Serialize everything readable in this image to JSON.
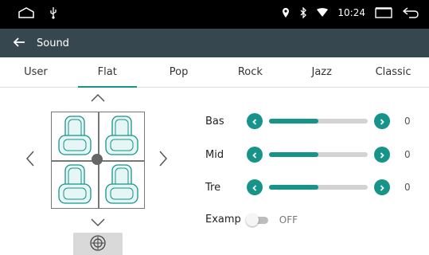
{
  "status_bar": {
    "time": "10:24",
    "icons": [
      "home-outline-icon",
      "usb-icon",
      "location-icon",
      "bluetooth-icon",
      "wifi-icon",
      "recent-apps-icon",
      "return-icon"
    ]
  },
  "header": {
    "title": "Sound",
    "background": "#37474f"
  },
  "tabs": [
    {
      "label": "User",
      "active": false
    },
    {
      "label": "Flat",
      "active": true
    },
    {
      "label": "Pop",
      "active": false
    },
    {
      "label": "Rock",
      "active": false
    },
    {
      "label": "Jazz",
      "active": false
    },
    {
      "label": "Classic",
      "active": false
    }
  ],
  "equalizer": {
    "accent": "#17948a",
    "bands": [
      {
        "label": "Bas",
        "value": "0",
        "level": 0.5
      },
      {
        "label": "Mid",
        "value": "0",
        "level": 0.5
      },
      {
        "label": "Tre",
        "value": "0",
        "level": 0.5
      }
    ]
  },
  "examp": {
    "label": "Examp",
    "state": "OFF",
    "on": false
  }
}
